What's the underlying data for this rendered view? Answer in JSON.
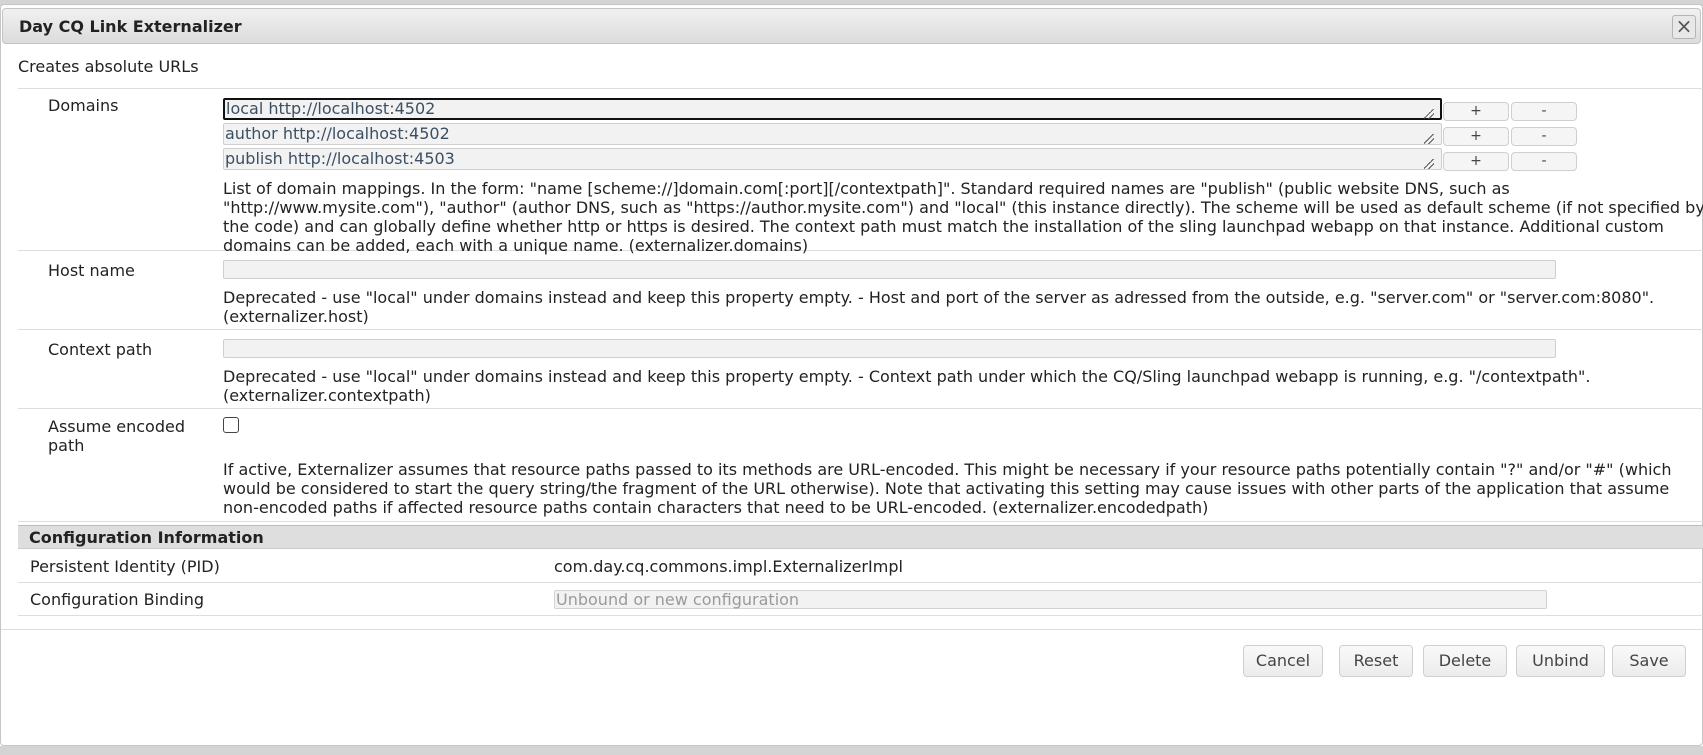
{
  "dialog": {
    "title": "Day CQ Link Externalizer",
    "close_glyph": "×",
    "subtitle": "Creates absolute URLs"
  },
  "domains": {
    "label": "Domains",
    "entries": [
      "local http://localhost:4502",
      "author http://localhost:4502",
      "publish http://localhost:4503"
    ],
    "add_label": "+",
    "remove_label": "-",
    "description": "List of domain mappings. In the form: \"name [scheme://]domain.com[:port][/contextpath]\". Standard required names are \"publish\" (public website DNS, such as \"http://www.mysite.com\"), \"author\" (author DNS, such as \"https://author.mysite.com\") and \"local\" (this instance directly). The scheme will be used as default scheme (if not specified by the code) and can globally define whether http or https is desired. The context path must match the installation of the sling launchpad webapp on that instance. Additional custom domains can be added, each with a unique name. (externalizer.domains)"
  },
  "host_name": {
    "label": "Host name",
    "value": "",
    "description": "Deprecated - use \"local\" under domains instead and keep this property empty. - Host and port of the server as adressed from the outside, e.g. \"server.com\" or \"server.com:8080\". (externalizer.host)"
  },
  "context_path": {
    "label": "Context path",
    "value": "",
    "description": "Deprecated - use \"local\" under domains instead and keep this property empty. - Context path under which the CQ/Sling launchpad webapp is running, e.g. \"/contextpath\". (externalizer.contextpath)"
  },
  "encoded_path": {
    "label": "Assume encoded path",
    "checked": false,
    "description": "If active, Externalizer assumes that resource paths passed to its methods are URL-encoded. This might be necessary if your resource paths potentially contain \"?\" and/or \"#\" (which would be considered to start the query string/the fragment of the URL otherwise). Note that activating this setting may cause issues with other parts of the application that assume non-encoded paths if affected resource paths contain characters that need to be URL-encoded. (externalizer.encodedpath)"
  },
  "config_info": {
    "title": "Configuration Information",
    "pid_label": "Persistent Identity (PID)",
    "pid_value": "com.day.cq.commons.impl.ExternalizerImpl",
    "binding_label": "Configuration Binding",
    "binding_placeholder": "Unbound or new configuration"
  },
  "footer": {
    "cancel": "Cancel",
    "reset": "Reset",
    "delete": "Delete",
    "unbind": "Unbind",
    "save": "Save"
  }
}
